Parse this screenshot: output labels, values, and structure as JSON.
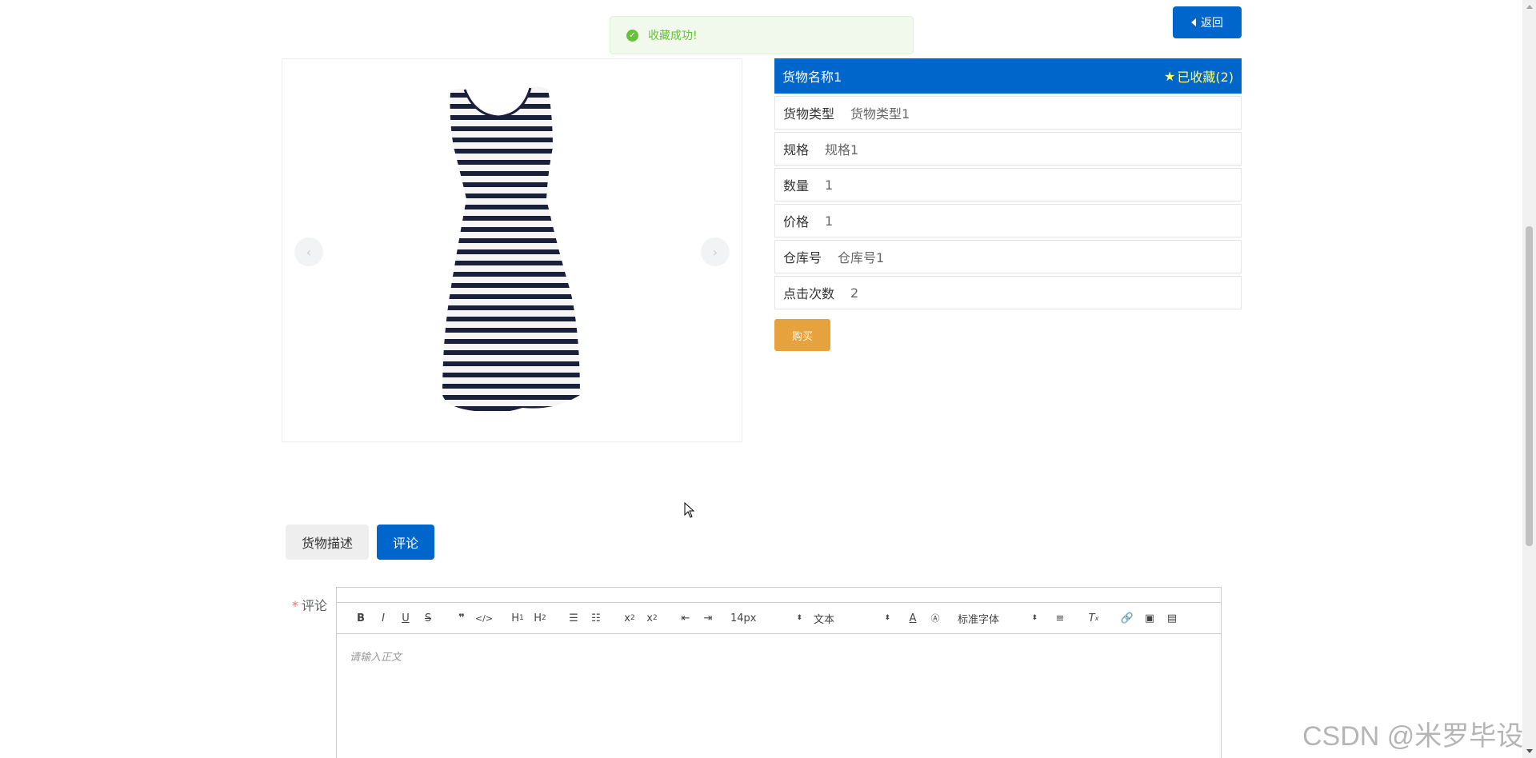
{
  "toast": {
    "message": "收藏成功!",
    "icon": "check-circle-icon",
    "color": "#67c23a"
  },
  "back_button": {
    "label": "返回"
  },
  "product": {
    "name": "货物名称1",
    "favorite_label": "已收藏(2)",
    "fields": [
      {
        "label": "货物类型",
        "value": "货物类型1"
      },
      {
        "label": "规格",
        "value": "规格1"
      },
      {
        "label": "数量",
        "value": "1"
      },
      {
        "label": "价格",
        "value": "1"
      },
      {
        "label": "仓库号",
        "value": "仓库号1"
      },
      {
        "label": "点击次数",
        "value": "2"
      }
    ],
    "buy_label": "购买"
  },
  "carousel": {
    "prev_glyph": "‹",
    "next_glyph": "›"
  },
  "tabs": [
    {
      "label": "货物描述",
      "active": false
    },
    {
      "label": "评论",
      "active": true
    }
  ],
  "comment": {
    "required_mark": "*",
    "label": "评论",
    "placeholder": "请输入正文",
    "toolbar": {
      "font_size": "14px",
      "paragraph": "文本",
      "font_family": "标准字体"
    }
  },
  "watermark": "CSDN @米罗毕设",
  "colors": {
    "primary": "#0066cc",
    "warning": "#e6a23c",
    "favorite": "#ffff66"
  }
}
